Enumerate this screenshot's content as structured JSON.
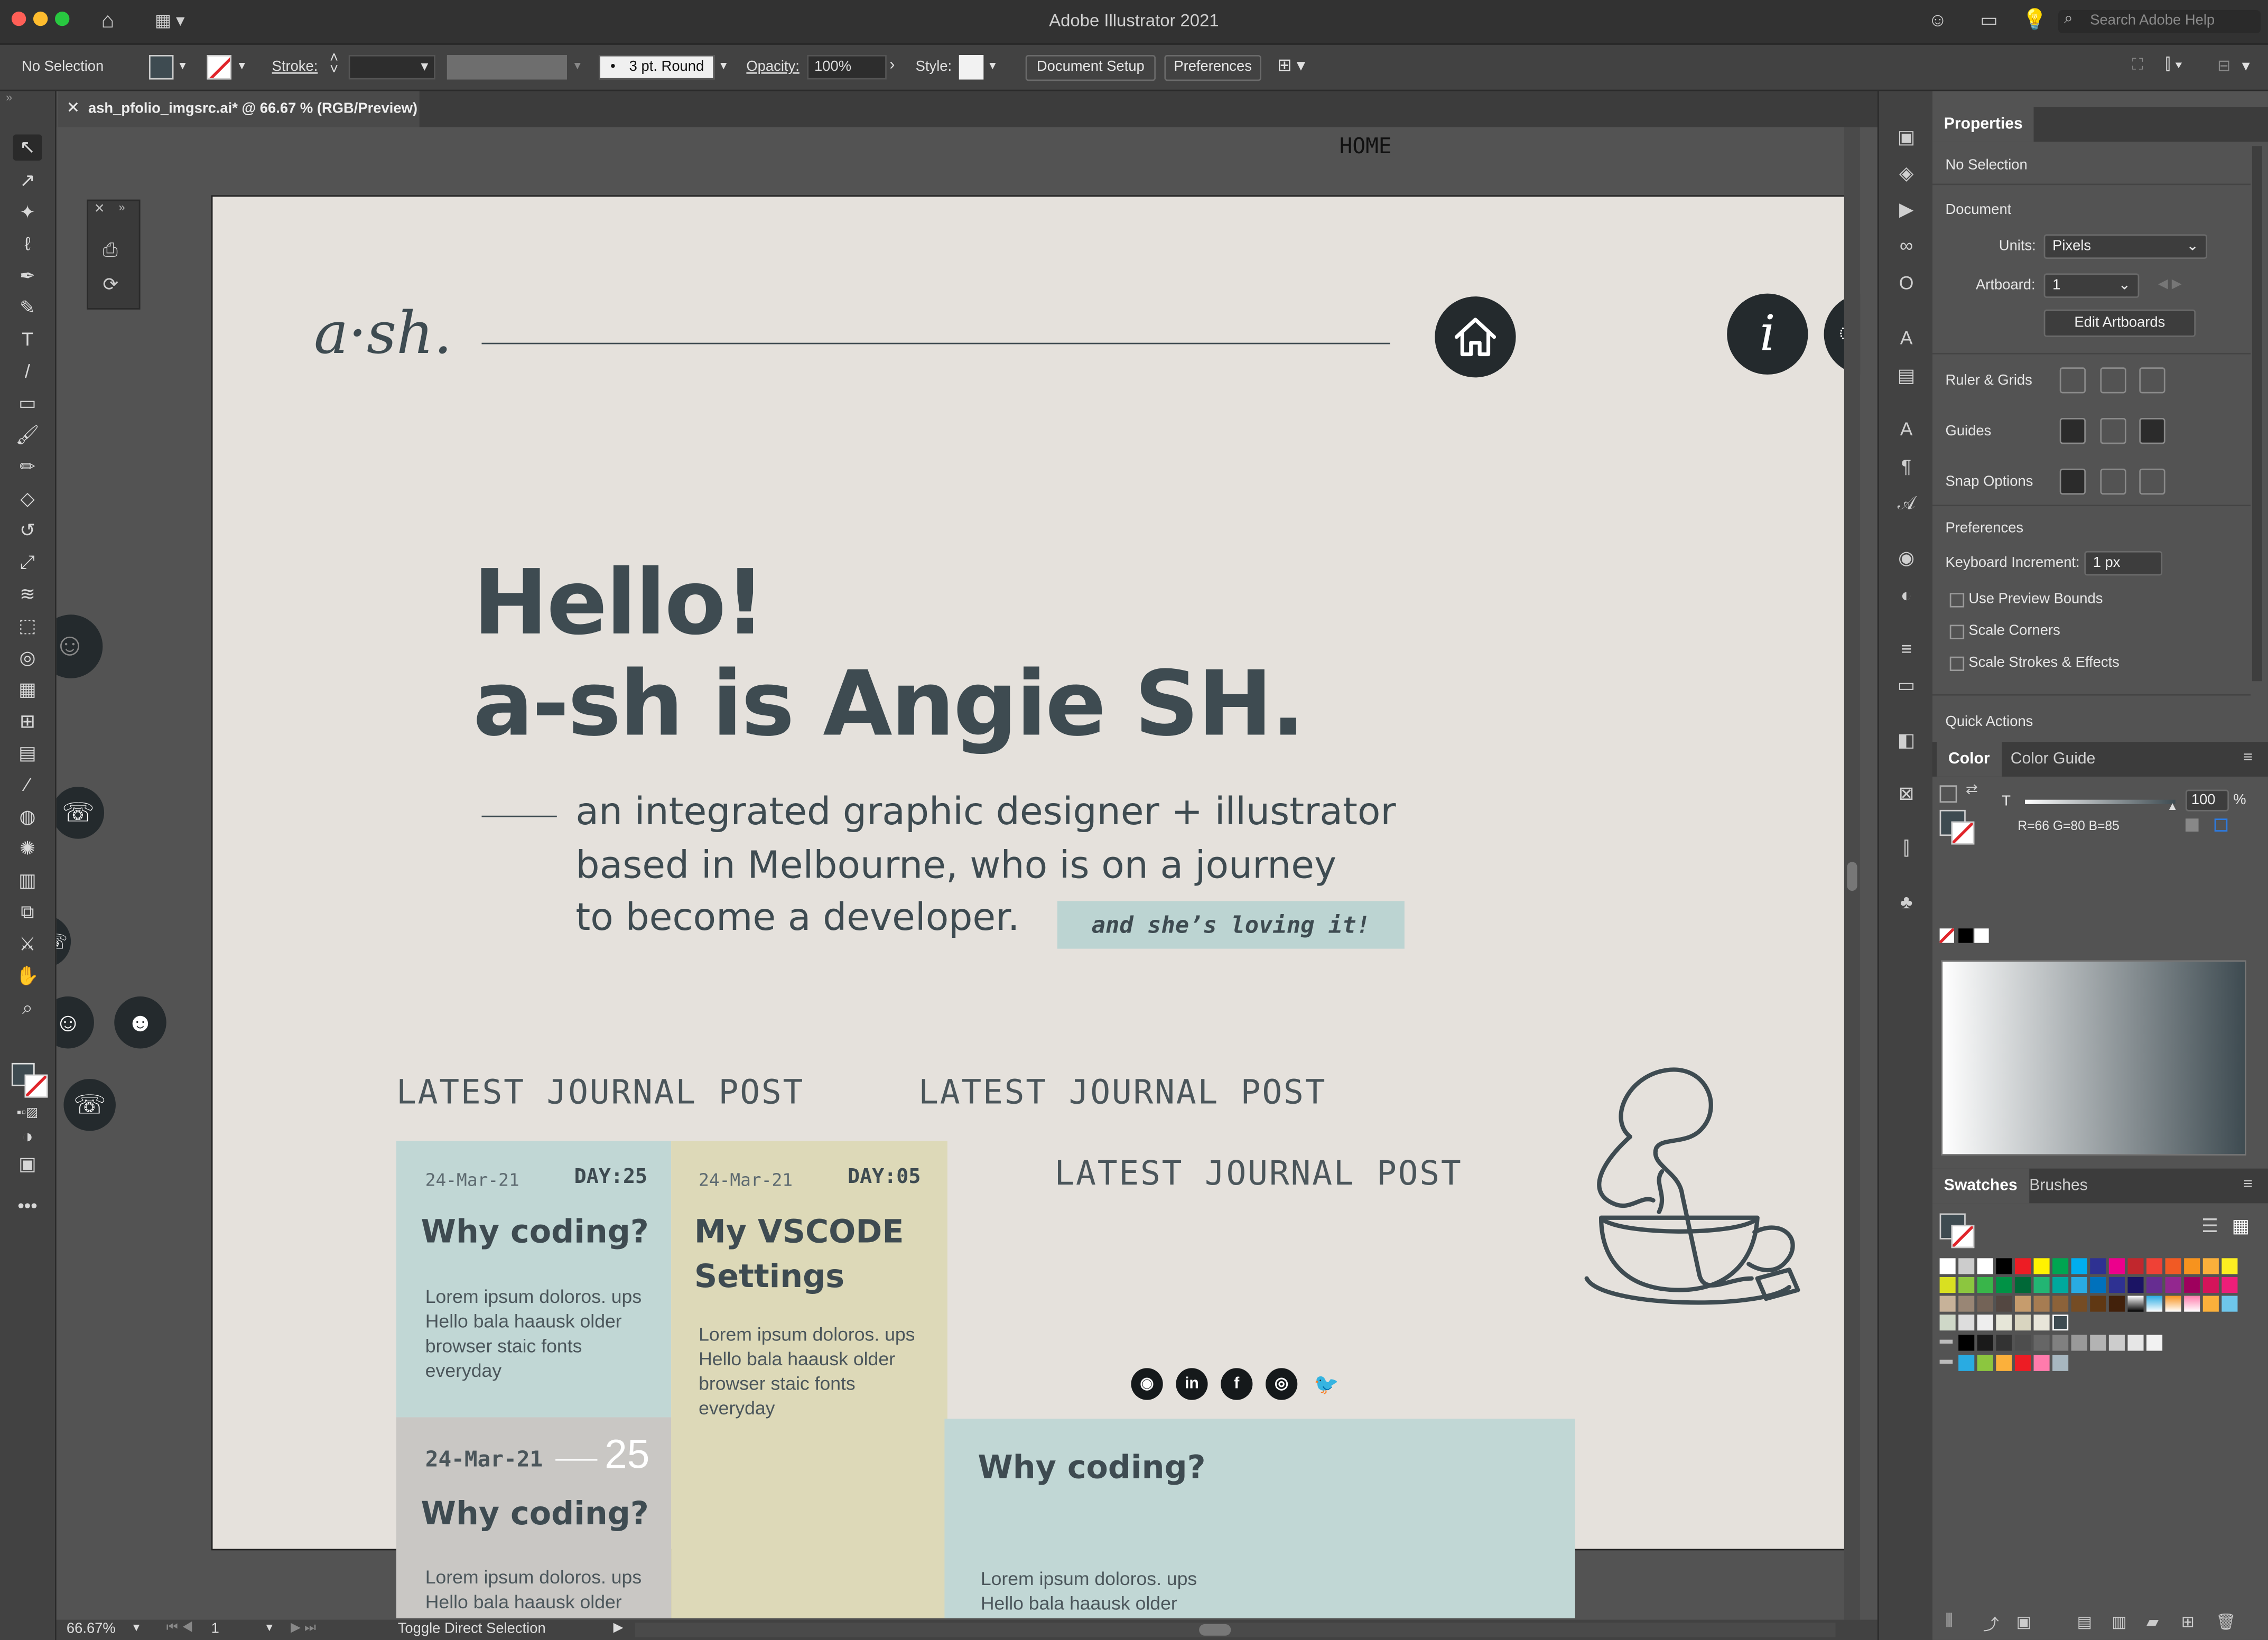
{
  "app": {
    "title": "Adobe Illustrator 2021",
    "search_placeholder": "Search Adobe Help"
  },
  "controlbar": {
    "selection": "No Selection",
    "stroke_label": "Stroke:",
    "brush_value": "3 pt. Round",
    "opacity_label": "Opacity:",
    "opacity_value": "100%",
    "style_label": "Style:",
    "document_setup": "Document Setup",
    "preferences": "Preferences"
  },
  "document": {
    "tab_title": "ash_pfolio_imgsrc.ai* @ 66.67 % (RGB/Preview)"
  },
  "artwork": {
    "home_label": "HOME",
    "logo": "a·sh.",
    "hello": "Hello!",
    "name_line": "a-sh is Angie SH.",
    "intro_lines": [
      "an integrated graphic designer + illustrator",
      "based in Melbourne, who is on a journey",
      "to become a developer."
    ],
    "tag": "and she’s loving it!",
    "journal_heading": "LATEST JOURNAL POST",
    "cards": [
      {
        "date": "24-Mar-21",
        "day": "DAY:25",
        "title": "Why coding?",
        "body": [
          "Lorem ipsum doloros. ups",
          "Hello bala haausk older",
          "browser staic fonts",
          "everyday"
        ]
      },
      {
        "date": "24-Mar-21",
        "day": "DAY:05",
        "title_lines": [
          "My VSCODE",
          "Settings"
        ],
        "body": [
          "Lorem ipsum doloros. ups",
          "Hello bala haausk older",
          "browser staic fonts",
          "everyday"
        ]
      },
      {
        "date": "24-Mar-21",
        "day": "25",
        "title": "Why coding?",
        "body": [
          "Lorem ipsum doloros. ups",
          "Hello bala haausk older"
        ]
      },
      {
        "title": "Why coding?",
        "body": [
          "Lorem ipsum doloros. ups",
          "Hello bala haausk older"
        ]
      }
    ],
    "colors": {
      "ink": "#3e4b51",
      "artboard": "#e5e1dc",
      "card_blue": "#c1d7d5",
      "card_yellow": "#ddd9b8",
      "card_grey": "#c9c7c4",
      "tag_bg": "#bcd4d2"
    }
  },
  "properties": {
    "tab": "Properties",
    "selection": "No Selection",
    "document_label": "Document",
    "units_label": "Units:",
    "units_value": "Pixels",
    "artboard_label": "Artboard:",
    "artboard_value": "1",
    "edit_artboards": "Edit Artboards",
    "ruler_grids": "Ruler & Grids",
    "guides": "Guides",
    "snap_options": "Snap Options",
    "preferences": "Preferences",
    "keyboard_increment_label": "Keyboard Increment:",
    "keyboard_increment_value": "1 px",
    "use_preview_bounds": "Use Preview Bounds",
    "scale_corners": "Scale Corners",
    "scale_strokes": "Scale Strokes & Effects",
    "quick_actions": "Quick Actions"
  },
  "color_panel": {
    "tab_color": "Color",
    "tab_color_guide": "Color Guide",
    "t_label": "T",
    "tint_value": "100",
    "percent": "%",
    "rgb_readout": "R=66 G=80 B=85"
  },
  "swatches_panel": {
    "tab_swatches": "Swatches",
    "tab_brushes": "Brushes"
  },
  "statusbar": {
    "zoom": "66.67%",
    "artboard_num": "1",
    "tool_hint": "Toggle Direct Selection"
  }
}
